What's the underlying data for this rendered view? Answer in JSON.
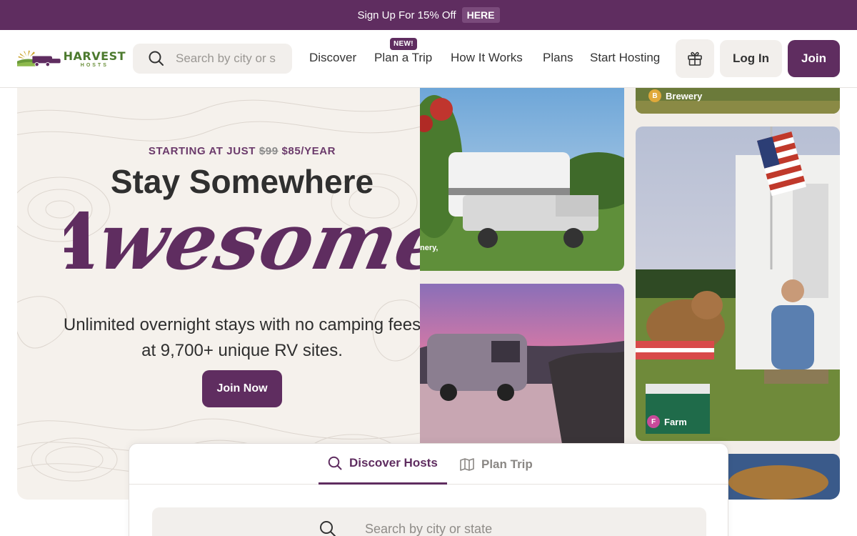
{
  "promo": {
    "text": "Sign Up For 15% Off",
    "link": "HERE"
  },
  "header": {
    "logo": {
      "main": "HARVEST",
      "sub": "HOSTS"
    },
    "search_placeholder": "Search by city or state",
    "nav": [
      "Discover",
      "Plan a Trip",
      "How It Works",
      "Plans",
      "Start Hosting"
    ],
    "badge": "NEW!",
    "login": "Log In",
    "join": "Join"
  },
  "hero": {
    "kicker_prefix": "STARTING AT JUST",
    "old_price": "$99",
    "new_price": "$85/YEAR",
    "headline": "Stay Somewhere",
    "script": "Awesome",
    "subcopy": "Unlimited overnight stays with no camping fees at 9,700+ unique RV sites.",
    "cta": "Join Now",
    "photo_labels": {
      "brewery": "Brewery",
      "farm": "Farm",
      "winery_fragment": "nery,"
    }
  },
  "search_card": {
    "tabs": [
      {
        "label": "Discover Hosts",
        "active": true
      },
      {
        "label": "Plan Trip",
        "active": false
      }
    ],
    "placeholder": "Search by city or state"
  },
  "colors": {
    "brand": "#5f2d60",
    "logo_green": "#4c7a2e",
    "background": "#f5f1ec"
  }
}
